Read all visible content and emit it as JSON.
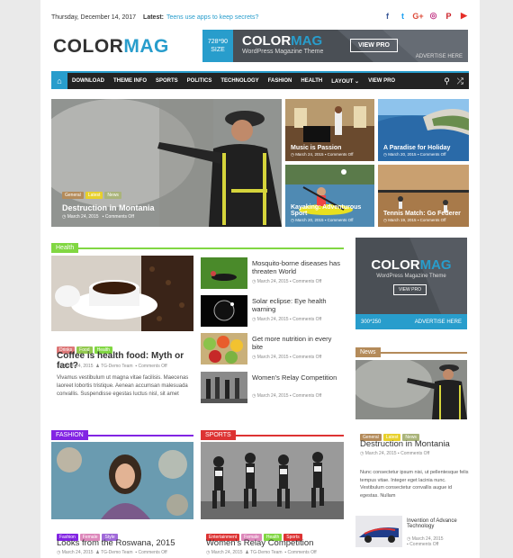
{
  "topbar": {
    "date": "Thursday, December 14, 2017",
    "latest_label": "Latest:",
    "latest_link": "Teens use apps to keep secrets?"
  },
  "social": [
    {
      "icon": "facebook-icon",
      "glyph": "f",
      "color": "#3b5998"
    },
    {
      "icon": "twitter-icon",
      "glyph": "t",
      "color": "#1da1f2"
    },
    {
      "icon": "google-plus-icon",
      "glyph": "G+",
      "color": "#dd4b39"
    },
    {
      "icon": "instagram-icon",
      "glyph": "◎",
      "color": "#c13584"
    },
    {
      "icon": "pinterest-icon",
      "glyph": "P",
      "color": "#cb2027"
    },
    {
      "icon": "youtube-icon",
      "glyph": "▶",
      "color": "#e52d27"
    }
  ],
  "logo": {
    "part1": "COLOR",
    "part2": "MAG"
  },
  "banner": {
    "size": "728*90",
    "size_label": "SIZE",
    "logo1": "COLOR",
    "logo2": "MAG",
    "sub": "WordPress Magazine Theme",
    "view_pro": "VIEW PRO",
    "advertise": "ADVERTISE HERE"
  },
  "nav": {
    "items": [
      "DOWNLOAD",
      "THEME INFO",
      "SPORTS",
      "POLITICS",
      "TECHNOLOGY",
      "FASHION",
      "HEALTH",
      "LAYOUT ⌄",
      "VIEW PRO"
    ]
  },
  "hero_main": {
    "tags": [
      "General",
      "Latest",
      "News"
    ],
    "title": "Destruction in Montania",
    "date": "March 24, 2015",
    "comments": "Comments Off"
  },
  "hero_small": [
    {
      "title": "Music is Passion",
      "date": "March 24, 2015",
      "comments": "Comments Off"
    },
    {
      "title": "A Paradise for Holiday",
      "date": "March 20, 2015",
      "comments": "Comments Off"
    },
    {
      "title": "Kayaking: Adventurous Sport",
      "date": "March 20, 2015",
      "comments": "Comments Off"
    },
    {
      "title": "Tennis Match: Go Federer",
      "date": "March 19, 2015",
      "comments": "Comments Off"
    }
  ],
  "colors": {
    "accent": "#289dcc",
    "health": "#81d742",
    "fashion": "#8224e3",
    "sports": "#dd3333",
    "news": "#b48b5a"
  },
  "health": {
    "label": "Health",
    "feature": {
      "tags": [
        "Drinks",
        "Food",
        "Health"
      ],
      "title": "Coffee is health food: Myth or fact?",
      "date": "March 24, 2015",
      "author": "TG-Demo Team",
      "comments": "Comments Off",
      "excerpt": "Vivamus vestibulum ut magna vitae facilisis. Maecenas laoreet lobortis tristique. Aenean accumsan malesuada convallis. Suspendisse egestas luctus nisl, sit amet"
    },
    "list": [
      {
        "title": "Mosquito-borne diseases has threaten World",
        "date": "March 24, 2015",
        "comments": "Comments Off"
      },
      {
        "title": "Solar eclipse: Eye health warning",
        "date": "March 24, 2015",
        "comments": "Comments Off"
      },
      {
        "title": "Get more nutrition in every bite",
        "date": "March 24, 2015",
        "comments": "Comments Off"
      },
      {
        "title": "Women's Relay Competition",
        "date": "March 24, 2015",
        "comments": "Comments Off"
      }
    ]
  },
  "ad300": {
    "logo1": "COLOR",
    "logo2": "MAG",
    "sub": "WordPress Magazine Theme",
    "view_pro": "VIEW PRO",
    "size": "300*250",
    "advertise": "ADVERTISE HERE"
  },
  "news": {
    "label": "News",
    "tags": [
      "General",
      "Latest",
      "News"
    ],
    "title": "Destruction in Montania",
    "date": "March 24, 2015",
    "comments": "Comments Off",
    "excerpt": "Nunc consectetur ipsum nisi, ut pellentesque felis tempus vitae. Integer eget lacinia nunc. Vestibulum consectetur convallis augue id egestas. Nullam",
    "small": {
      "title": "Invention of Advance Technology",
      "date": "March 24, 2015",
      "comments": "Comments Off"
    }
  },
  "fashion": {
    "label": "FASHION",
    "tags": [
      "Fashion",
      "Female",
      "Style"
    ],
    "title": "Looks from the Roswana, 2015",
    "date": "March 24, 2015",
    "author": "TG-Demo Team",
    "comments": "Comments Off"
  },
  "sports": {
    "label": "SPORTS",
    "tags": [
      "Entertainment",
      "Female",
      "Health",
      "Sports"
    ],
    "title": "Women's Relay Competition",
    "date": "March 24, 2015",
    "author": "TG-Demo Team",
    "comments": "Comments Off"
  }
}
